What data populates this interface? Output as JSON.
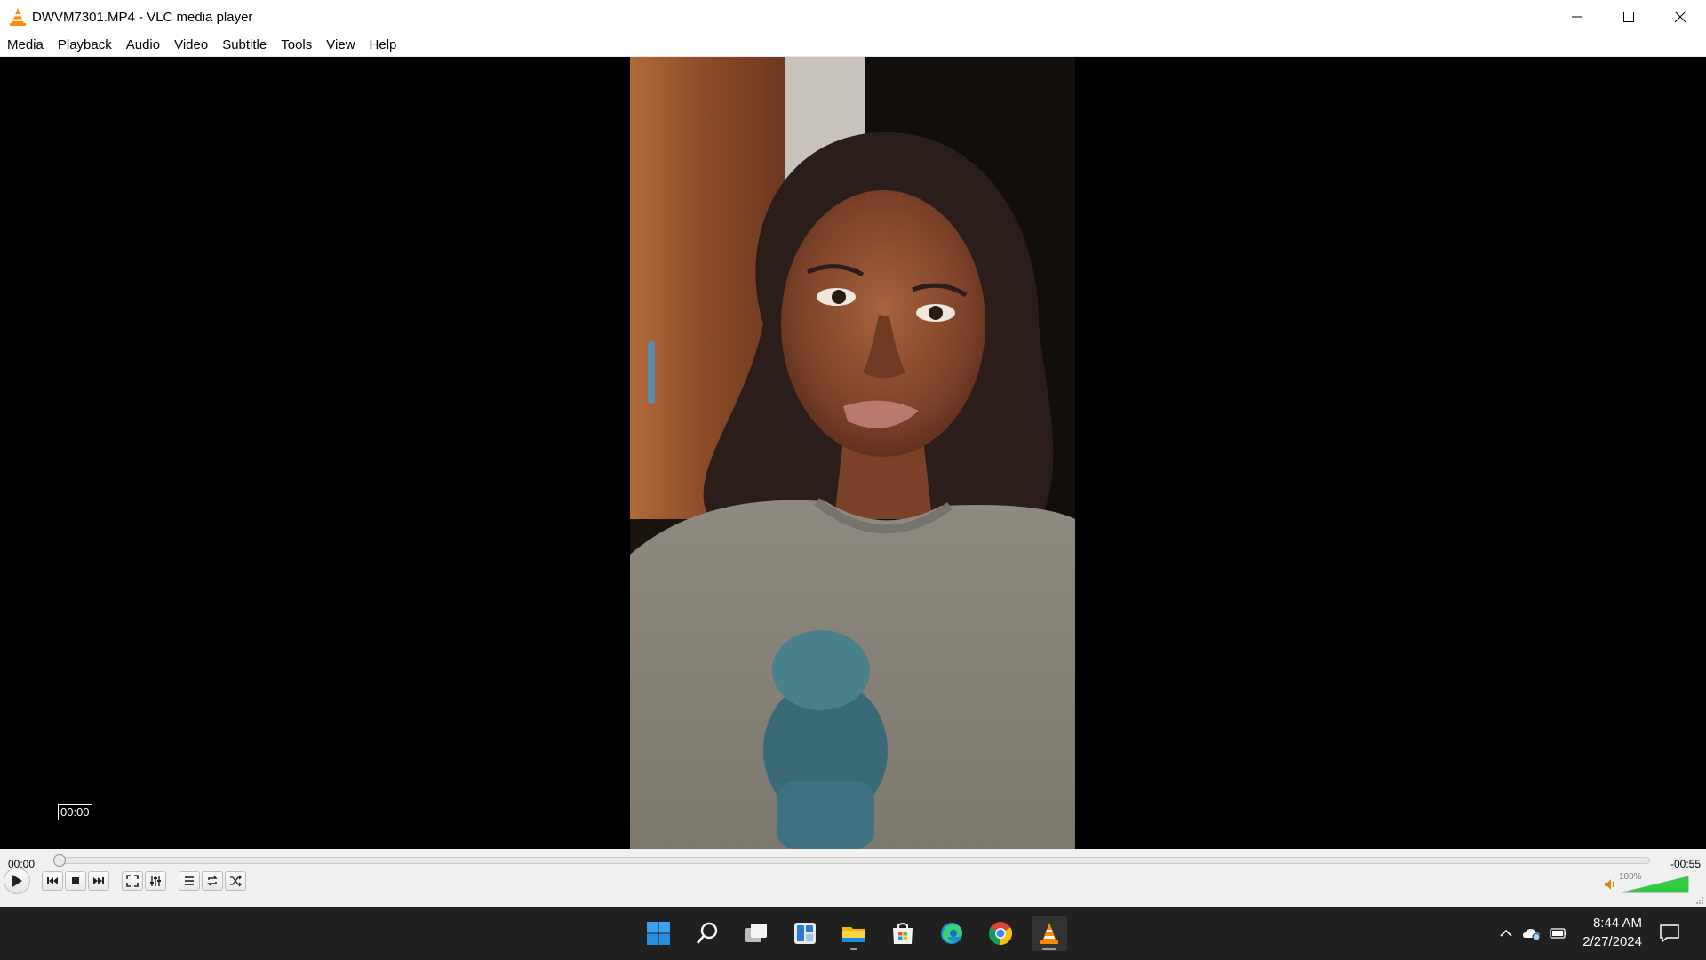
{
  "window": {
    "title": "DWVM7301.MP4 - VLC media player",
    "icon": "vlc-cone-icon",
    "controls": [
      "minimize-icon",
      "maximize-icon",
      "close-icon"
    ]
  },
  "menu": {
    "items": [
      {
        "label": "Media"
      },
      {
        "label": "Playback"
      },
      {
        "label": "Audio"
      },
      {
        "label": "Video"
      },
      {
        "label": "Subtitle"
      },
      {
        "label": "Tools"
      },
      {
        "label": "View"
      },
      {
        "label": "Help"
      }
    ]
  },
  "player": {
    "seek_tooltip": "00:00",
    "time_elapsed": "00:00",
    "time_remaining": "-00:55",
    "progress": 0,
    "buttons": [
      "play-icon",
      "previous-icon",
      "stop-icon",
      "next-icon",
      "fullscreen-icon",
      "extended-settings-icon",
      "playlist-icon",
      "loop-icon",
      "shuffle-icon"
    ],
    "volume_label": "100%",
    "volume": 1.0
  },
  "taskbar": {
    "apps": [
      "windows-start-icon",
      "search-icon",
      "task-view-icon",
      "widgets-icon",
      "file-explorer-icon",
      "microsoft-store-icon",
      "edge-icon",
      "chrome-icon",
      "vlc-icon"
    ],
    "tray": [
      "chevron-up-icon",
      "onedrive-icon",
      "battery-icon"
    ],
    "time": "8:44 AM",
    "date": "2/27/2024",
    "notification_icon": "notification-icon"
  },
  "colors": {
    "vlc_orange": "#ff8800",
    "volume_green": "#2ecc40",
    "taskbar_bg": "#202020",
    "controls_bg": "#f0f0f0"
  }
}
